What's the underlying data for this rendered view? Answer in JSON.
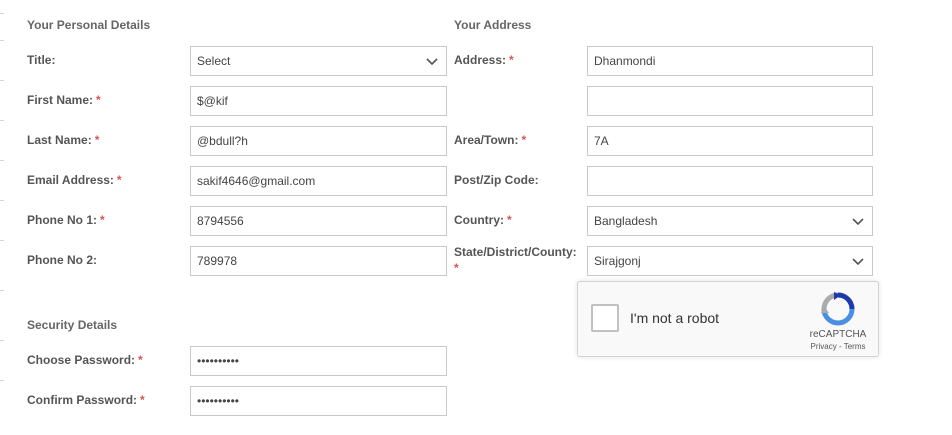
{
  "personal": {
    "section_title": "Your Personal Details",
    "title": {
      "label": "Title:",
      "value": "Select"
    },
    "first_name": {
      "label": "First Name:",
      "value": "$@kif"
    },
    "last_name": {
      "label": "Last Name:",
      "value": "@bdull?h"
    },
    "email": {
      "label": "Email Address:",
      "value": "sakif4646@gmail.com"
    },
    "phone1": {
      "label": "Phone No 1:",
      "value": "8794556"
    },
    "phone2": {
      "label": "Phone No 2:",
      "value": "789978"
    }
  },
  "address": {
    "section_title": "Your Address",
    "address1": {
      "label": "Address:",
      "value": "Dhanmondi"
    },
    "address2": {
      "value": ""
    },
    "area": {
      "label": "Area/Town:",
      "value": "7A"
    },
    "postcode": {
      "label": "Post/Zip Code:",
      "value": ""
    },
    "country": {
      "label": "Country:",
      "value": "Bangladesh"
    },
    "state": {
      "label": "State/District/County:",
      "value": "Sirajgonj"
    }
  },
  "security": {
    "section_title": "Security Details",
    "choose_password": {
      "label": "Choose Password:",
      "value": "••••••••••"
    },
    "confirm_password": {
      "label": "Confirm Password:",
      "value": "••••••••••"
    }
  },
  "required_marker": "*",
  "recaptcha": {
    "checkbox_label": "I'm not a robot",
    "brand": "reCAPTCHA",
    "privacy": "Privacy",
    "separator": "-",
    "terms": "Terms"
  },
  "colors": {
    "required": "#d9534f",
    "border": "#c9c9c9",
    "recaptcha_blue": "#4a90e2"
  }
}
